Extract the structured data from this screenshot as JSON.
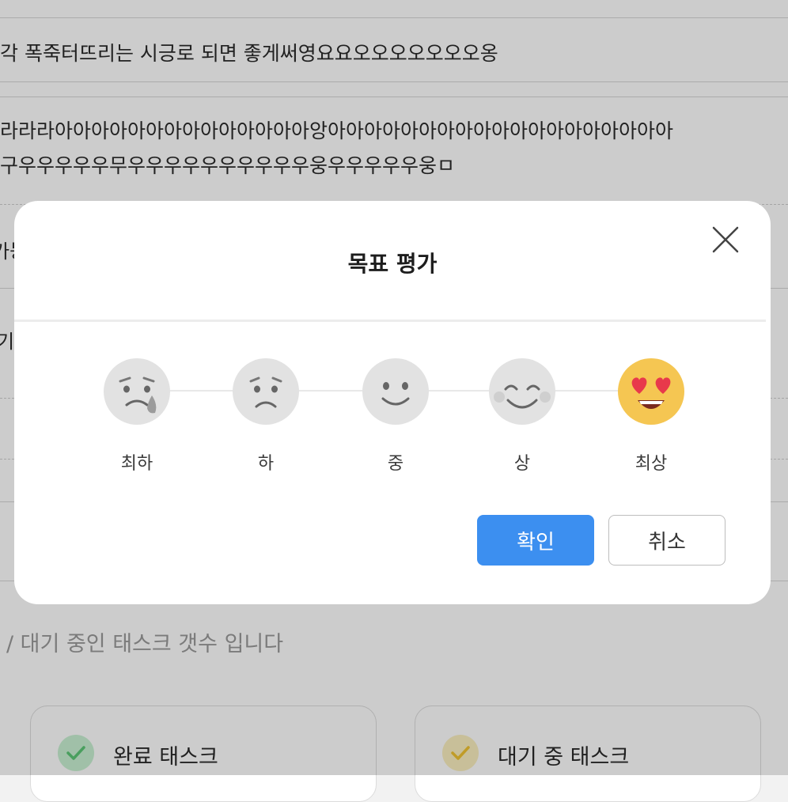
{
  "background": {
    "row1_text": "각 폭죽터뜨리는 시긍로 되면 좋게써영요요오오오오오오오옹",
    "row2_text": "라라라아아아아아아아아아아아아아아앙아아아아아아아아아아아아아아아아아아아",
    "row3_text": "구우우우우우무우우우우우우우우우우웅우우우우우웅ㅁ",
    "partial_text_a": "가능",
    "partial_text_b": "기",
    "description": "/ 대기 중인 태스크 갯수 입니다",
    "card_done_label": "완료 태스크",
    "card_waiting_label": "대기 중 태스크"
  },
  "modal": {
    "title": "목표 평가",
    "options": [
      {
        "label": "최하",
        "icon": "crying-face-icon"
      },
      {
        "label": "하",
        "icon": "sad-face-icon"
      },
      {
        "label": "중",
        "icon": "neutral-smile-face-icon"
      },
      {
        "label": "상",
        "icon": "happy-face-icon"
      },
      {
        "label": "최상",
        "icon": "heart-eyes-face-icon"
      }
    ],
    "selected_index": 4,
    "confirm_label": "확인",
    "cancel_label": "취소"
  },
  "colors": {
    "accent": "#3c8ff0",
    "face_selected": "#f5c652",
    "heart": "#e8394b",
    "face_inactive": "#e0e0e0"
  }
}
